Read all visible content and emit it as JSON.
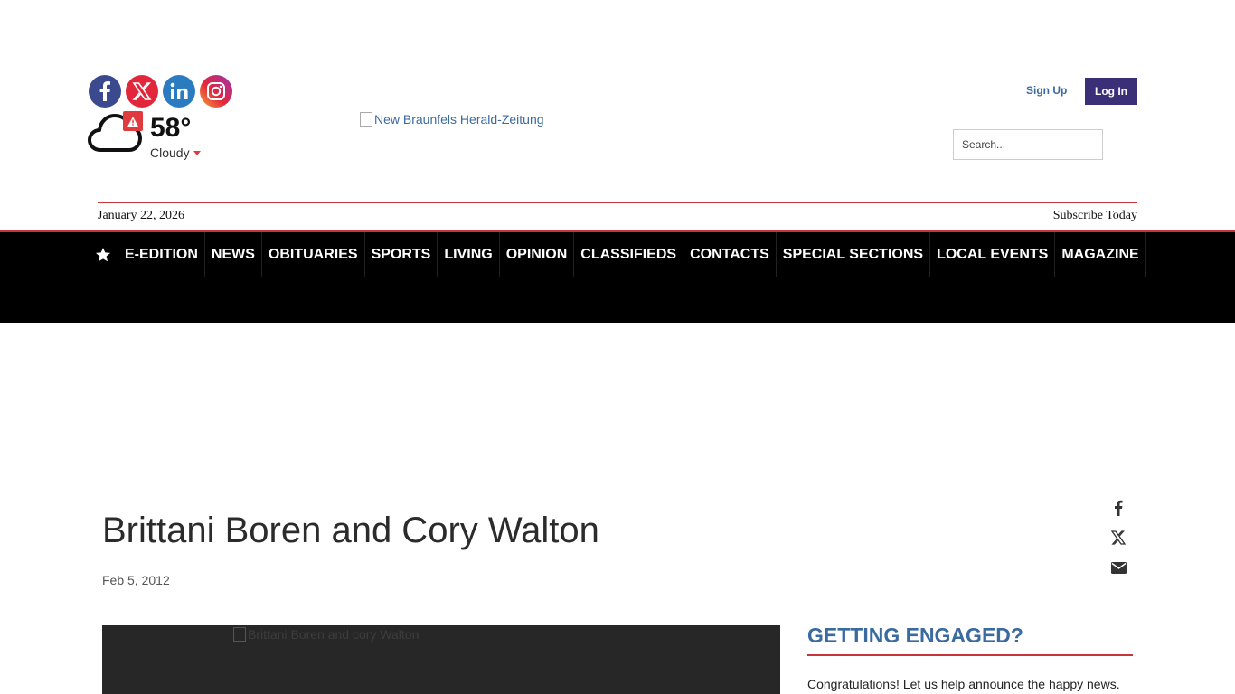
{
  "header": {
    "social": [
      "facebook-icon",
      "x-icon",
      "linkedin-icon",
      "instagram-icon"
    ],
    "weather": {
      "temp": "58°",
      "condition": "Cloudy"
    },
    "logo_alt": "New Braunfels Herald-Zeitung",
    "signup_label": "Sign Up",
    "login_label": "Log In",
    "search_placeholder": "Search...",
    "date": "January 22, 2026",
    "subscribe": "Subscribe Today"
  },
  "nav": {
    "items": [
      "E-EDITION",
      "NEWS",
      "OBITUARIES",
      "SPORTS",
      "LIVING",
      "OPINION",
      "CLASSIFIEDS",
      "CONTACTS",
      "SPECIAL SECTIONS",
      "LOCAL EVENTS",
      "MAGAZINE"
    ]
  },
  "article": {
    "title": "Brittani Boren and Cory Walton",
    "date": "Feb 5, 2012",
    "photo_alt": "Brittani Boren and cory Walton"
  },
  "sidebar": {
    "heading": "GETTING ENGAGED?",
    "text": "Congratulations! Let us help announce the happy news."
  },
  "colors": {
    "accent": "#c8343a",
    "link": "#3a6aa0",
    "login_bg": "#3b3078",
    "nav_bg": "#000000"
  }
}
